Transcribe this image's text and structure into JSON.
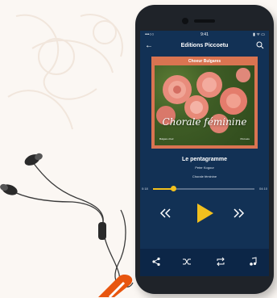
{
  "status": {
    "carrier": "•••○○",
    "time": "9:41",
    "icons": "▮ ᯤ ▭"
  },
  "header": {
    "title": "Editions Piccoetu"
  },
  "album": {
    "top_label": "Choeur Bulgares",
    "script_title": "Chorale féminine",
    "small_left": "Bulgare choir",
    "small_right": "Piccoetu"
  },
  "track": {
    "title": "Le pentagramme",
    "author": "Peter Kogour",
    "album": "Chorale féminine",
    "elapsed": "0:18",
    "total": "04:10",
    "progress": 0.2
  },
  "colors": {
    "screen": "#123155",
    "cover": "#d97451",
    "accent": "#f2c01e",
    "bottom_bar": "#0c2647"
  },
  "icons": {
    "back": "back-arrow-icon",
    "search": "search-icon",
    "rewind": "rewind-icon",
    "play": "play-icon",
    "forward": "fast-forward-icon",
    "share": "share-icon",
    "shuffle": "shuffle-icon",
    "repeat": "repeat-icon",
    "playlist": "music-note-icon"
  }
}
